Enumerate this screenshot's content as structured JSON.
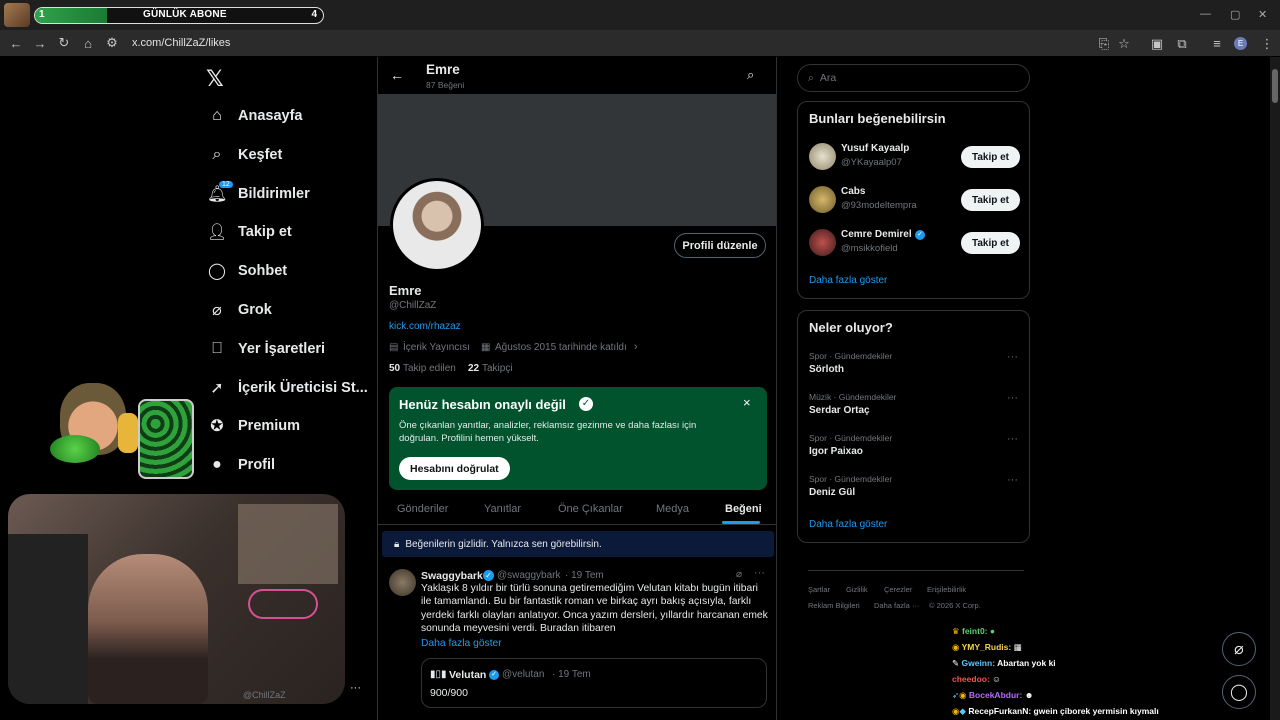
{
  "browser": {
    "url": "x.com/ChillZaZ/likes",
    "subscriber_goal": {
      "label": "GÜNLÜK ABONE",
      "current": "1",
      "target": "4",
      "progress": 0.25
    },
    "profile_initial": "E"
  },
  "nav": {
    "items": [
      {
        "label": "Anasayfa",
        "icon": "home-icon"
      },
      {
        "label": "Keşfet",
        "icon": "search-icon"
      },
      {
        "label": "Bildirimler",
        "icon": "bell-icon",
        "badge": "12"
      },
      {
        "label": "Takip et",
        "icon": "person-add-icon"
      },
      {
        "label": "Sohbet",
        "icon": "chat-icon"
      },
      {
        "label": "Grok",
        "icon": "grok-icon"
      },
      {
        "label": "Yer İşaretleri",
        "icon": "bookmark-icon"
      },
      {
        "label": "İçerik Üreticisi St...",
        "icon": "rocket-icon"
      },
      {
        "label": "Premium",
        "icon": "verified-icon"
      },
      {
        "label": "Profil",
        "icon": "profile-icon"
      }
    ],
    "account_handle": "@ChillZaZ"
  },
  "profile": {
    "header_name": "Emre",
    "header_count": "87 Beğeni",
    "name": "Emre",
    "handle": "@ChillZaZ",
    "link": "kick.com/rhazaz",
    "category": "İçerik Yayıncısı",
    "joined": "Ağustos 2015 tarihinde katıldı",
    "following_count": "50",
    "following_label": "Takip edilen",
    "followers_count": "22",
    "followers_label": "Takipçi",
    "edit_button": "Profili düzenle"
  },
  "verify_card": {
    "title": "Henüz hesabın onaylı değil",
    "body": "Öne çıkanlan yanıtlar, analizler, reklamsız gezinme ve daha fazlası için doğrulan. Profilini hemen yükselt.",
    "button": "Hesabını doğrulat",
    "close": "×"
  },
  "tabs": [
    "Gönderiler",
    "Yanıtlar",
    "Öne Çıkanlar",
    "Medya",
    "Beğeni"
  ],
  "privacy_notice": "Beğenilerin gizlidir. Yalnızca sen görebilirsin.",
  "tweet": {
    "author": "Swaggybark",
    "handle": "@swaggybark",
    "time": "· 19 Tem",
    "text": "Yaklaşık 8 yıldır bir türlü sonuna getiremediğim Velutan kitabı bugün itibari ile tamamlandı. Bu bir fantastik roman ve birkaç ayrı bakış açısıyla, farklı yerdeki farklı olayları anlatıyor. Onca yazım dersleri, yıllardır harcanan emek sonunda meyvesini verdi. Buradan itibaren",
    "show_more": "Daha fazla göster",
    "quote_author": "Velutan",
    "quote_handle": "@velutan",
    "quote_time": "· 19 Tem",
    "quote_text": "900/900"
  },
  "right": {
    "search_placeholder": "Ara",
    "suggest_title": "Bunları beğenebilirsin",
    "suggestions": [
      {
        "name": "Yusuf Kayaalp",
        "handle": "@YKayaalp07",
        "button": "Takip et"
      },
      {
        "name": "Cabs",
        "handle": "@93modeltempra",
        "button": "Takip et"
      },
      {
        "name": "Cemre Demirel",
        "handle": "@msikkofield",
        "button": "Takip et"
      }
    ],
    "suggest_more": "Daha fazla göster",
    "trends_title": "Neler oluyor?",
    "trends": [
      {
        "category": "Spor · Gündemdekiler",
        "name": "Sörloth"
      },
      {
        "category": "Müzik · Gündemdekiler",
        "name": "Serdar Ortaç"
      },
      {
        "category": "Spor · Gündemdekiler",
        "name": "Igor Paixao"
      },
      {
        "category": "Spor · Gündemdekiler",
        "name": "Deniz Gül"
      }
    ],
    "trends_more": "Daha fazla göster",
    "footer": [
      "Şartlar",
      "Gizlilik",
      "Çerezler",
      "Erişilebilirlik",
      "Reklam Bilgileri",
      "Daha fazla ···",
      "© 2026 X Corp."
    ]
  },
  "chat": [
    {
      "user": "feint0:",
      "message": "",
      "color": "#58d26b"
    },
    {
      "user": "YMY_Rudis:",
      "message": "",
      "color": "#f5d442"
    },
    {
      "user": "Gweinn:",
      "message": "Abartan yok ki",
      "color": "#59c7ff"
    },
    {
      "user": "cheedoo:",
      "message": "",
      "color": "#ff4d4d"
    },
    {
      "user": "BocekAbdur:",
      "message": "",
      "color": "#b36bff"
    },
    {
      "user": "RecepFurkanN:",
      "message": "gwein çiborek yermisin kıymalı",
      "color": "#ffffff"
    }
  ]
}
